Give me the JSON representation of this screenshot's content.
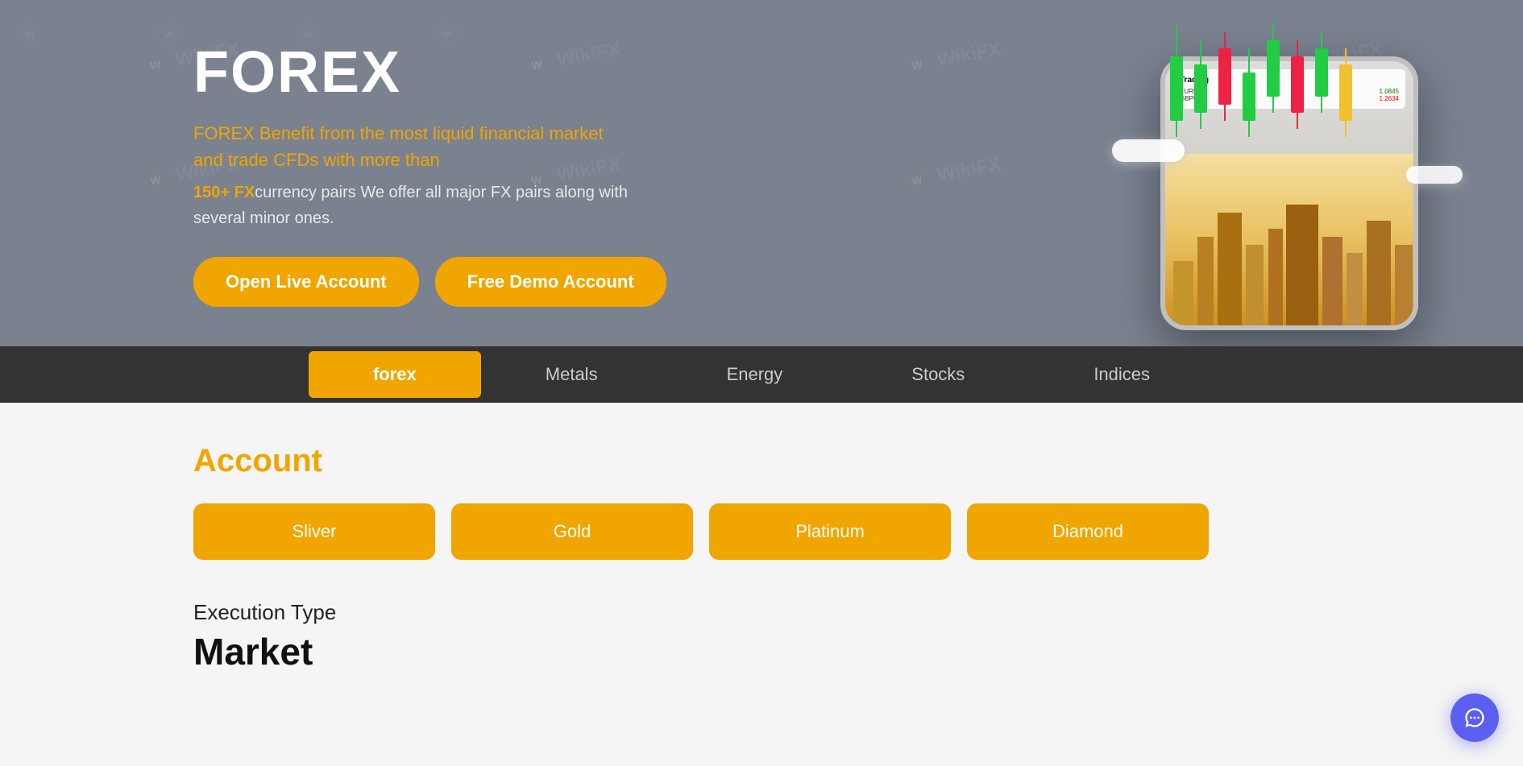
{
  "hero": {
    "title": "FOREX",
    "subtitle": "FOREX Benefit from the most liquid financial market and trade CFDs with more than",
    "desc_highlight": "150+ FX",
    "desc_rest": "currency pairs We offer all major FX pairs along with several minor ones.",
    "btn_live": "Open Live Account",
    "btn_demo": "Free Demo Account"
  },
  "tabs": [
    {
      "id": "forex",
      "label": "forex",
      "active": true
    },
    {
      "id": "metals",
      "label": "Metals",
      "active": false
    },
    {
      "id": "energy",
      "label": "Energy",
      "active": false
    },
    {
      "id": "stocks",
      "label": "Stocks",
      "active": false
    },
    {
      "id": "indices",
      "label": "Indices",
      "active": false
    }
  ],
  "main": {
    "section_title": "Account",
    "account_types": [
      {
        "id": "sliver",
        "label": "Sliver"
      },
      {
        "id": "gold",
        "label": "Gold"
      },
      {
        "id": "platinum",
        "label": "Platinum"
      },
      {
        "id": "diamond",
        "label": "Diamond"
      }
    ],
    "execution_label": "Execution Type",
    "execution_value": "Market"
  },
  "watermark": {
    "text": "WikiFX"
  },
  "chat": {
    "label": "Chat"
  }
}
